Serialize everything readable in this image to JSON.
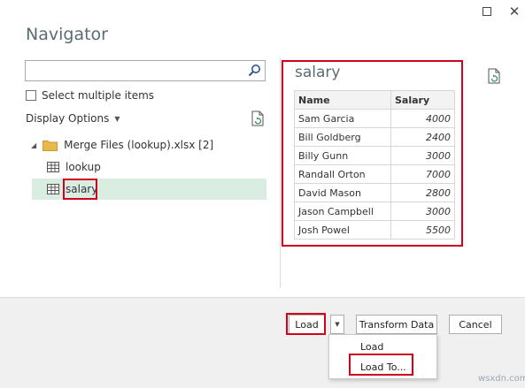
{
  "window": {
    "maximize_icon": "maximize-icon",
    "close_icon": "close-icon",
    "close_glyph": "✕"
  },
  "title": "Navigator",
  "search": {
    "value": "",
    "placeholder": "",
    "icon": "search-icon"
  },
  "select_multiple": {
    "label": "Select multiple items",
    "checked": false
  },
  "display_options": {
    "label": "Display Options",
    "caret": "▼"
  },
  "tree": {
    "root": {
      "arrow": "◢",
      "label": "Merge Files (lookup).xlsx [2]",
      "icon": "folder-icon"
    },
    "items": [
      {
        "label": "lookup",
        "icon": "table-icon",
        "selected": false
      },
      {
        "label": "salary",
        "icon": "table-icon",
        "selected": true
      }
    ]
  },
  "preview": {
    "title": "salary",
    "columns": [
      "Name",
      "Salary"
    ],
    "rows": [
      [
        "Sam Garcia",
        "4000"
      ],
      [
        "Bill Goldberg",
        "2400"
      ],
      [
        "Billy Gunn",
        "3000"
      ],
      [
        "Randall Orton",
        "7000"
      ],
      [
        "David Mason",
        "2800"
      ],
      [
        "Jason Campbell",
        "3000"
      ],
      [
        "Josh Powel",
        "5500"
      ]
    ]
  },
  "footer": {
    "load_label": "Load",
    "dropdown_caret": "▼",
    "transform_label": "Transform Data",
    "cancel_label": "Cancel"
  },
  "load_menu": [
    "Load",
    "Load To..."
  ],
  "watermark": "wsxdn.com",
  "colors": {
    "highlight": "#d0021b",
    "selected_row": "#d9ede3",
    "title": "#5a6b73"
  }
}
